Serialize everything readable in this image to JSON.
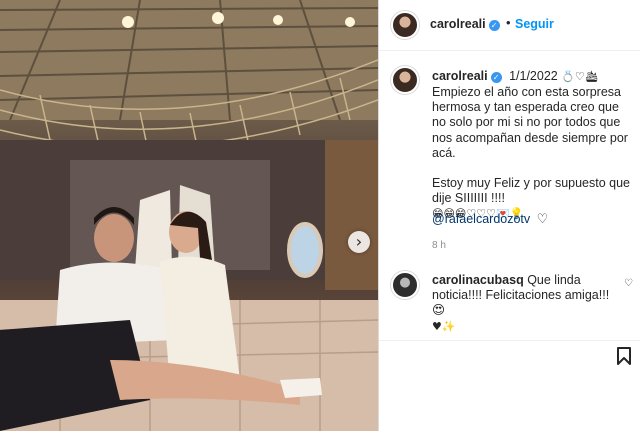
{
  "post": {
    "username": "carolreali",
    "follow_label": "Seguir",
    "separator": "•",
    "date": "1/1/2022",
    "caption_emojis": "💍♡🛳",
    "caption_paragraph1": "Empiezo el año con esta sorpresa hermosa y tan esperada creo que no solo por mi si no por todos que nos acompañan desde siempre por acá.",
    "caption_paragraph2": "Estoy muy Feliz y por supuesto que dije SIIIIIII !!!!",
    "caption_emoji_row": "😁😁😁♡♡♡💌💡",
    "mention": "@rafaelcardozotv",
    "time_ago": "8 h"
  },
  "comment": {
    "username": "carolinacubasq",
    "text": "Que linda noticia!!!! Felicitaciones amiga!!! 😍",
    "emoji_tail": "♥✨"
  },
  "icons": {
    "verified": "verified-badge-icon",
    "heart": "heart-outline-icon",
    "bookmark": "bookmark-icon",
    "carousel": "chevron-right-icon"
  },
  "colors": {
    "link": "#00376b",
    "follow": "#0095f6",
    "verified": "#3897f0",
    "muted": "#8e8e8e"
  }
}
